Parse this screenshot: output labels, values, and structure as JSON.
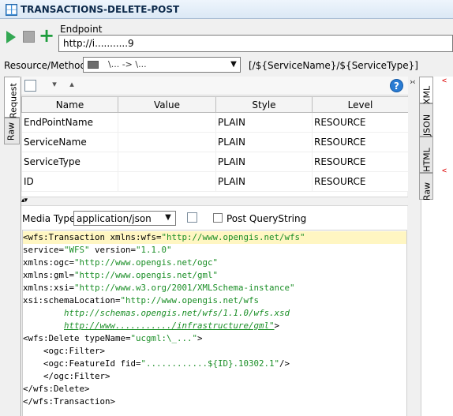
{
  "window": {
    "title": "TRANSACTIONS-DELETE-POST"
  },
  "request": {
    "endpoint_label": "Endpoint",
    "endpoint_value": "http://i...........9",
    "resource_label": "Resource/Method:",
    "resource_value": "\\... -> \\...",
    "resource_path": "[/${ServiceName}/${ServiceType}]"
  },
  "tabs": {
    "left": [
      "Request",
      "Raw"
    ],
    "right": [
      "XML",
      "JSON",
      "HTML",
      "Raw"
    ]
  },
  "params": {
    "headers": [
      "Name",
      "Value",
      "Style",
      "Level"
    ],
    "rows": [
      [
        "EndPointName",
        "",
        "PLAIN",
        "RESOURCE"
      ],
      [
        "ServiceName",
        "",
        "PLAIN",
        "RESOURCE"
      ],
      [
        "ServiceType",
        "",
        "PLAIN",
        "RESOURCE"
      ],
      [
        "ID",
        "",
        "PLAIN",
        "RESOURCE"
      ]
    ]
  },
  "media": {
    "label": "Media Type",
    "value": "application/json",
    "post_querystring": "Post QueryString"
  },
  "body": {
    "lines": [
      [
        "<wfs:Transaction xmlns:wfs=",
        "\"http://www.opengis.net/wfs\""
      ],
      [
        "service=",
        "\"WFS\"",
        " version=",
        "\"1.1.0\""
      ],
      [
        "xmlns:ogc=",
        "\"http://www.opengis.net/ogc\""
      ],
      [
        "xmlns:gml=",
        "\"http://www.opengis.net/gml\""
      ],
      [
        "xmlns:xsi=",
        "\"http://www.w3.org/2001/XMLSchema-instance\""
      ],
      [
        "xsi:schemaLocation=",
        "\"http://www.opengis.net/wfs"
      ],
      [
        "        ",
        "http://schemas.opengis.net/wfs/1.1.0/wfs.xsd"
      ],
      [
        "        ",
        "http://www.........../infrastructure/gml\"",
        ">"
      ],
      [
        "<wfs:Delete typeName=",
        "\"ucgml:\\_...\"",
        ">"
      ],
      [
        "    <ogc:Filter>"
      ],
      [
        "    <ogc:FeatureId fid=",
        "\"............${ID}.10302.1\"",
        "/>"
      ],
      [
        "    </ogc:Filter>"
      ],
      [
        "</wfs:Delete>"
      ],
      [
        "</wfs:Transaction>"
      ]
    ]
  }
}
